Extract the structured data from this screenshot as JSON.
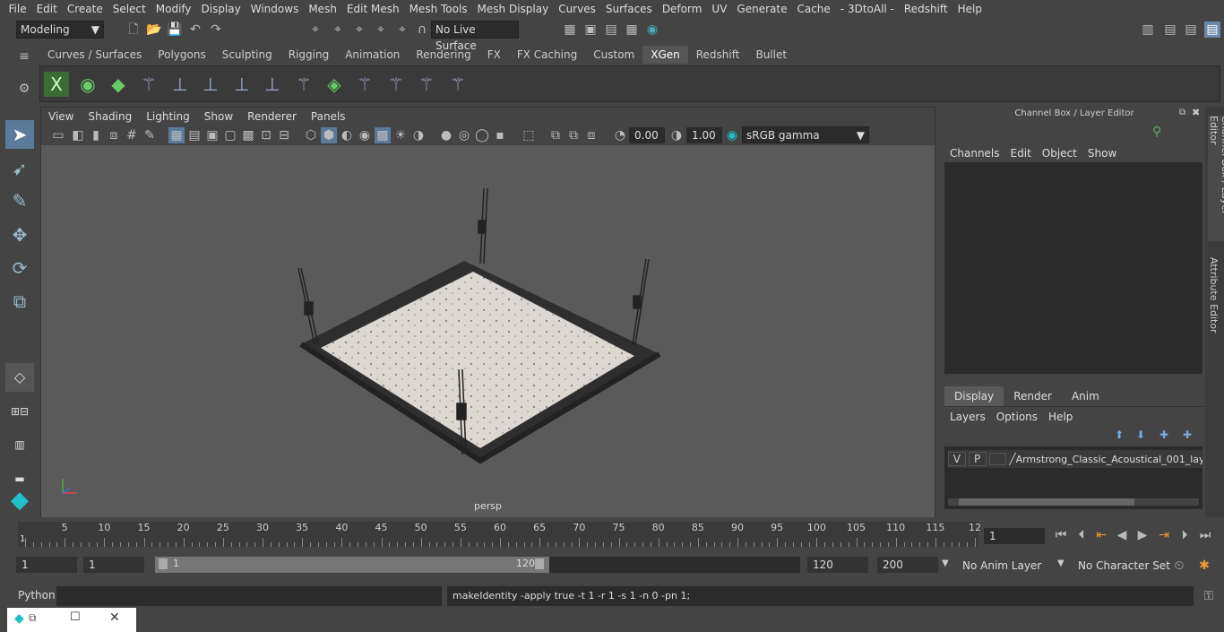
{
  "menubar": [
    "File",
    "Edit",
    "Create",
    "Select",
    "Modify",
    "Display",
    "Windows",
    "Mesh",
    "Edit Mesh",
    "Mesh Tools",
    "Mesh Display",
    "Curves",
    "Surfaces",
    "Deform",
    "UV",
    "Generate",
    "Cache",
    "- 3DtoAll -",
    "Redshift",
    "Help"
  ],
  "status": {
    "workspace": "Modeling",
    "live_surface": "No Live Surface"
  },
  "shelf_tabs": [
    "Curves / Surfaces",
    "Polygons",
    "Sculpting",
    "Rigging",
    "Animation",
    "Rendering",
    "FX",
    "FX Caching",
    "Custom",
    "XGen",
    "Redshift",
    "Bullet"
  ],
  "shelf_active": "XGen",
  "viewport": {
    "menu": [
      "View",
      "Shading",
      "Lighting",
      "Show",
      "Renderer",
      "Panels"
    ],
    "exposure": "0.00",
    "gamma": "1.00",
    "color_space": "sRGB gamma",
    "camera_label": "persp"
  },
  "channel_box": {
    "title": "Channel Box / Layer Editor",
    "menu": [
      "Channels",
      "Edit",
      "Object",
      "Show"
    ],
    "tabs": [
      "Display",
      "Render",
      "Anim"
    ],
    "active_tab": "Display",
    "layer_menu": [
      "Layers",
      "Options",
      "Help"
    ],
    "layer": {
      "v": "V",
      "p": "P",
      "name": "Armstrong_Classic_Acoustical_001_lay"
    }
  },
  "side_tabs": [
    "Channel Box / Layer Editor",
    "Attribute Editor"
  ],
  "timeline": {
    "ticks": [
      "5",
      "10",
      "15",
      "20",
      "25",
      "30",
      "35",
      "40",
      "45",
      "50",
      "55",
      "60",
      "65",
      "70",
      "75",
      "80",
      "85",
      "90",
      "95",
      "100",
      "105",
      "110",
      "115",
      "12"
    ],
    "start_label": "1",
    "current_frame": "1"
  },
  "range": {
    "start": "1",
    "inner_start": "1",
    "slider_start": "1",
    "slider_end": "120",
    "end": "120",
    "anim_end": "200",
    "anim_layer": "No Anim Layer",
    "char_set": "No Character Set"
  },
  "cmd": {
    "lang": "Python",
    "output": "makeIdentity -apply true -t 1 -r 1 -s 1 -n 0 -pn 1;"
  }
}
